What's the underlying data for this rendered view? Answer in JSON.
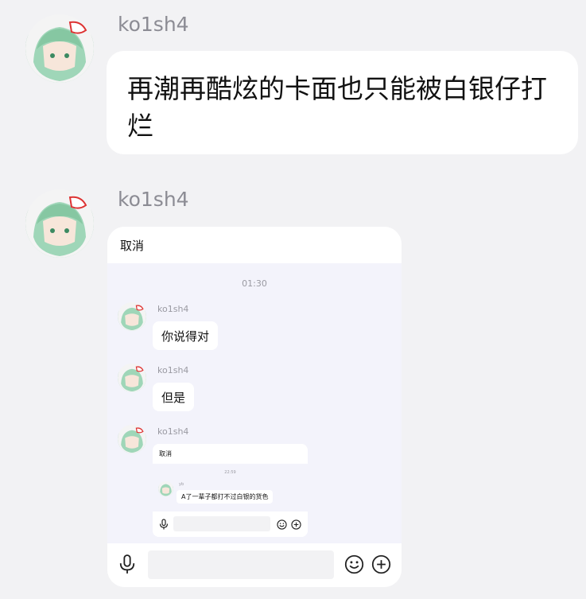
{
  "messages": [
    {
      "sender": "ko1sh4",
      "text": "再潮再酷炫的卡面也只能被白银仔打烂"
    },
    {
      "sender": "ko1sh4",
      "screenshot": {
        "cancel": "取消",
        "time": "01:30",
        "messages": [
          {
            "sender": "ko1sh4",
            "text": "你说得对"
          },
          {
            "sender": "ko1sh4",
            "text": "但是"
          },
          {
            "sender": "ko1sh4",
            "screenshot": {
              "cancel": "取消",
              "time": "22:59",
              "messages": [
                {
                  "sender": "yb",
                  "text": "A了一辈子都打不过白银的货色"
                }
              ]
            }
          }
        ]
      }
    }
  ],
  "icons": {
    "mic": "microphone-icon",
    "emoji": "smiley-icon",
    "plus": "plus-circle-icon"
  }
}
